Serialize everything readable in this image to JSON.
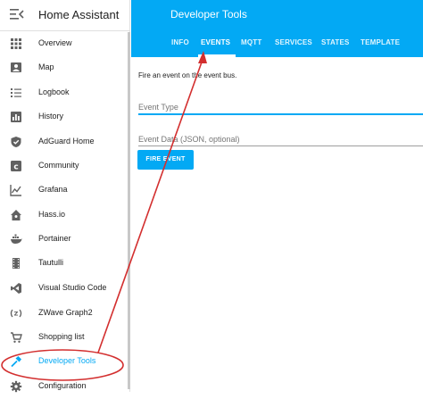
{
  "sidebar": {
    "title": "Home Assistant",
    "items": [
      {
        "label": "Overview",
        "icon": "grid-icon"
      },
      {
        "label": "Map",
        "icon": "map-icon"
      },
      {
        "label": "Logbook",
        "icon": "list-icon"
      },
      {
        "label": "History",
        "icon": "chart-bar-icon"
      },
      {
        "label": "AdGuard Home",
        "icon": "shield-check-icon"
      },
      {
        "label": "Community",
        "icon": "community-icon"
      },
      {
        "label": "Grafana",
        "icon": "chart-line-icon"
      },
      {
        "label": "Hass.io",
        "icon": "home-assistant-icon"
      },
      {
        "label": "Portainer",
        "icon": "docker-whale-icon"
      },
      {
        "label": "Tautulli",
        "icon": "film-icon"
      },
      {
        "label": "Visual Studio Code",
        "icon": "vscode-icon"
      },
      {
        "label": "ZWave Graph2",
        "icon": "zwave-icon"
      },
      {
        "label": "Shopping list",
        "icon": "cart-icon"
      },
      {
        "label": "Developer Tools",
        "icon": "hammer-icon"
      },
      {
        "label": "Configuration",
        "icon": "gear-icon"
      }
    ]
  },
  "topbar": {
    "title": "Developer Tools",
    "tabs": [
      "INFO",
      "EVENTS",
      "MQTT",
      "SERVICES",
      "STATES",
      "TEMPLATE"
    ],
    "active_tab": "EVENTS"
  },
  "main": {
    "description": "Fire an event on the event bus.",
    "event_type_label": "Event Type",
    "event_data_label": "Event Data (JSON, optional)",
    "fire_button": "FIRE EVENT"
  },
  "colors": {
    "accent": "#03a9f4",
    "annotation": "#d32f2f"
  }
}
